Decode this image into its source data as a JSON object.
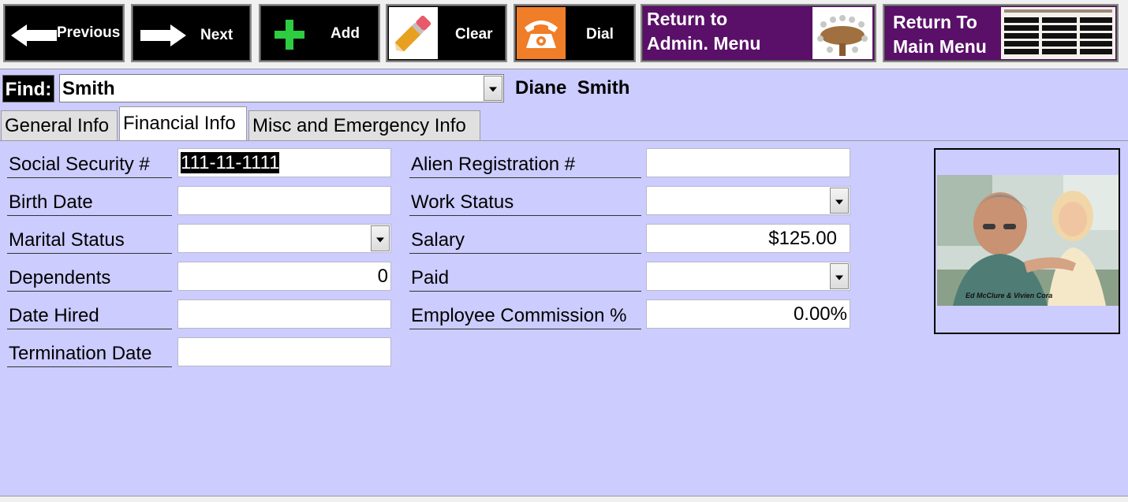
{
  "toolbar": {
    "previous": "Previous",
    "next": "Next",
    "add": "Add",
    "clear": "Clear",
    "dial": "Dial",
    "return_admin_line1": "Return to",
    "return_admin_line2": "Admin. Menu",
    "return_main_line1": "Return To",
    "return_main_line2": "Main Menu"
  },
  "find": {
    "label": "Find:",
    "value": "Smith",
    "display_name": "Diane  Smith"
  },
  "tabs": [
    {
      "label": "General Info",
      "active": false
    },
    {
      "label": "Financial Info",
      "active": true
    },
    {
      "label": "Misc and Emergency Info",
      "active": false
    }
  ],
  "form": {
    "left": [
      {
        "label": "Social Security #",
        "value": "111-11-1111",
        "type": "text"
      },
      {
        "label": "Birth Date",
        "value": "",
        "type": "text"
      },
      {
        "label": "Marital Status",
        "value": "",
        "type": "select"
      },
      {
        "label": "Dependents",
        "value": "0",
        "type": "number"
      },
      {
        "label": "Date Hired",
        "value": "",
        "type": "text"
      },
      {
        "label": "Termination Date",
        "value": "",
        "type": "text"
      }
    ],
    "right": [
      {
        "label": "Alien Registration #",
        "value": "",
        "type": "text"
      },
      {
        "label": "Work Status",
        "value": "",
        "type": "select"
      },
      {
        "label": "Salary",
        "value": "$125.00",
        "type": "currency"
      },
      {
        "label": "Paid",
        "value": "",
        "type": "select"
      },
      {
        "label": "Employee Commission %",
        "value": "0.00%",
        "type": "percent"
      }
    ]
  },
  "photo": {
    "caption": "Ed McClure & Vivien Cora"
  },
  "colors": {
    "background": "#ccccff",
    "toolbar_button": "#000000",
    "menu_button": "#5a1068",
    "add_icon": "#2ecc40",
    "dial_icon": "#f07d28"
  },
  "icons": [
    "arrow-left-icon",
    "arrow-right-icon",
    "plus-icon",
    "eraser-icon",
    "telephone-icon",
    "conference-table-icon",
    "main-menu-thumbnail-icon",
    "chevron-down-icon"
  ]
}
